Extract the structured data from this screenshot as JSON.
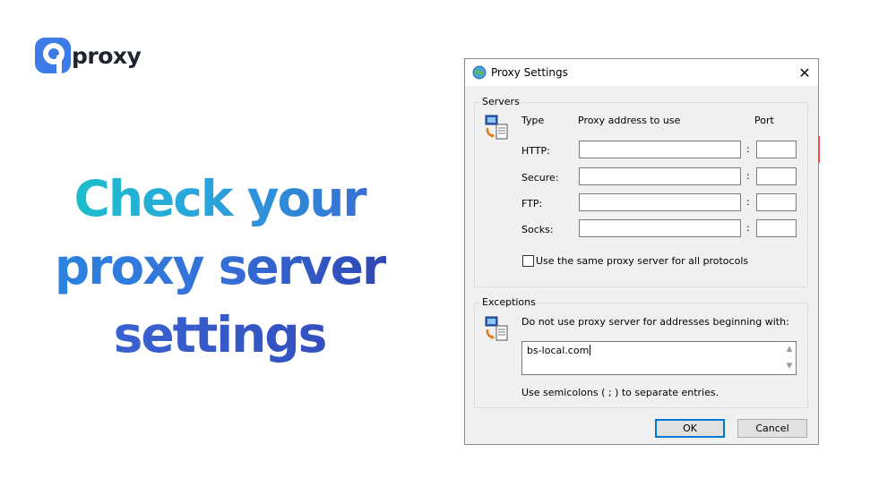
{
  "brand": {
    "logo_text": "proxy",
    "logo_icon": "proxy-logo-icon",
    "colors": {
      "logo": "#3d7be8",
      "headline_start": "#17c6c4",
      "headline_end": "#2f3fb0"
    }
  },
  "headline": {
    "line1": "Check your",
    "line2": "proxy server",
    "line3": "settings"
  },
  "dialog": {
    "title": "Proxy Settings",
    "close_glyph": "✕",
    "servers": {
      "legend": "Servers",
      "col_type": "Type",
      "col_address": "Proxy address to use",
      "col_port": "Port",
      "rows": [
        {
          "label": "HTTP:",
          "address": "",
          "port": ""
        },
        {
          "label": "Secure:",
          "address": "",
          "port": ""
        },
        {
          "label": "FTP:",
          "address": "",
          "port": ""
        },
        {
          "label": "Socks:",
          "address": "",
          "port": ""
        }
      ],
      "same_proxy_label": "Use the same proxy server for all protocols",
      "same_proxy_checked": false
    },
    "exceptions": {
      "legend": "Exceptions",
      "description": "Do not use proxy server for addresses beginning with:",
      "value": "bs-local.com",
      "hint": "Use semicolons ( ; ) to separate entries."
    },
    "buttons": {
      "ok": "OK",
      "cancel": "Cancel"
    }
  }
}
